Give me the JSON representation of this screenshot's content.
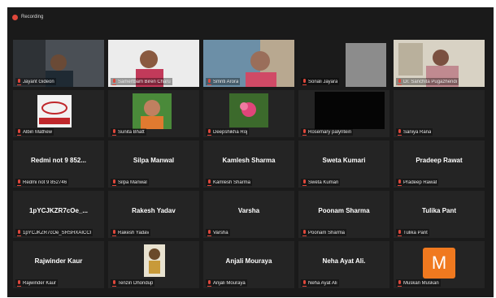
{
  "recording": {
    "label": "Recording"
  },
  "colors": {
    "background": "#1a1a1a",
    "tile": "#242424",
    "muted_mic": "#e0473b",
    "active_border": "#c7d84a",
    "avatar_m": "#f0791f"
  },
  "participants": [
    {
      "label": "Jayant Gideon",
      "big_name": "",
      "video": true
    },
    {
      "label": "Samertbam Biren Charu",
      "big_name": "",
      "video": true
    },
    {
      "label": "Smriti Arora",
      "big_name": "",
      "video": true
    },
    {
      "label": "Sonali Jayara",
      "big_name": "",
      "video": true
    },
    {
      "label": "Dr. Sanchita Pugazhendi",
      "big_name": "",
      "video": true,
      "active": true
    },
    {
      "label": "Albin Mathew",
      "big_name": "",
      "video": true
    },
    {
      "label": "Sunita Bhatt",
      "big_name": "",
      "video": true
    },
    {
      "label": "Deepshikha Roj",
      "big_name": "",
      "video": true
    },
    {
      "label": "Rosemary palyntein",
      "big_name": "",
      "video": true
    },
    {
      "label": "Saniya Rana",
      "big_name": "",
      "video": false
    },
    {
      "label": "Redmi not 9 852746",
      "big_name": "Redmi not 9 852...",
      "video": false
    },
    {
      "label": "Silpa Manwal",
      "big_name": "Silpa Manwal",
      "video": false
    },
    {
      "label": "Kamlesh Sharma",
      "big_name": "Kamlesh Sharma",
      "video": false
    },
    {
      "label": "Sweta Kumari",
      "big_name": "Sweta Kumari",
      "video": false
    },
    {
      "label": "Pradeep Rawat",
      "big_name": "Pradeep Rawat",
      "video": false
    },
    {
      "label": "1pYCJKZR7cOe_SRSHXAICCI",
      "big_name": "1pYCJKZR7cOe_...",
      "video": false
    },
    {
      "label": "Rakesh Yadav",
      "big_name": "Rakesh Yadav",
      "video": false
    },
    {
      "label": "Varsha",
      "big_name": "Varsha",
      "video": false
    },
    {
      "label": "Poonam Sharma",
      "big_name": "Poonam Sharma",
      "video": false
    },
    {
      "label": "Tulika Pant",
      "big_name": "Tulika Pant",
      "video": false
    },
    {
      "label": "Rajwinder Kaur",
      "big_name": "Rajwinder Kaur",
      "video": false
    },
    {
      "label": "Tenzin Dhondup",
      "big_name": "",
      "video": true
    },
    {
      "label": "Anjali Mouraya",
      "big_name": "Anjali Mouraya",
      "video": false
    },
    {
      "label": "Neha Ayat Ali",
      "big_name": "Neha Ayat Ali.",
      "video": false
    },
    {
      "label": "Muskan Muskan",
      "big_name": "",
      "video": false,
      "avatar": "M"
    }
  ]
}
